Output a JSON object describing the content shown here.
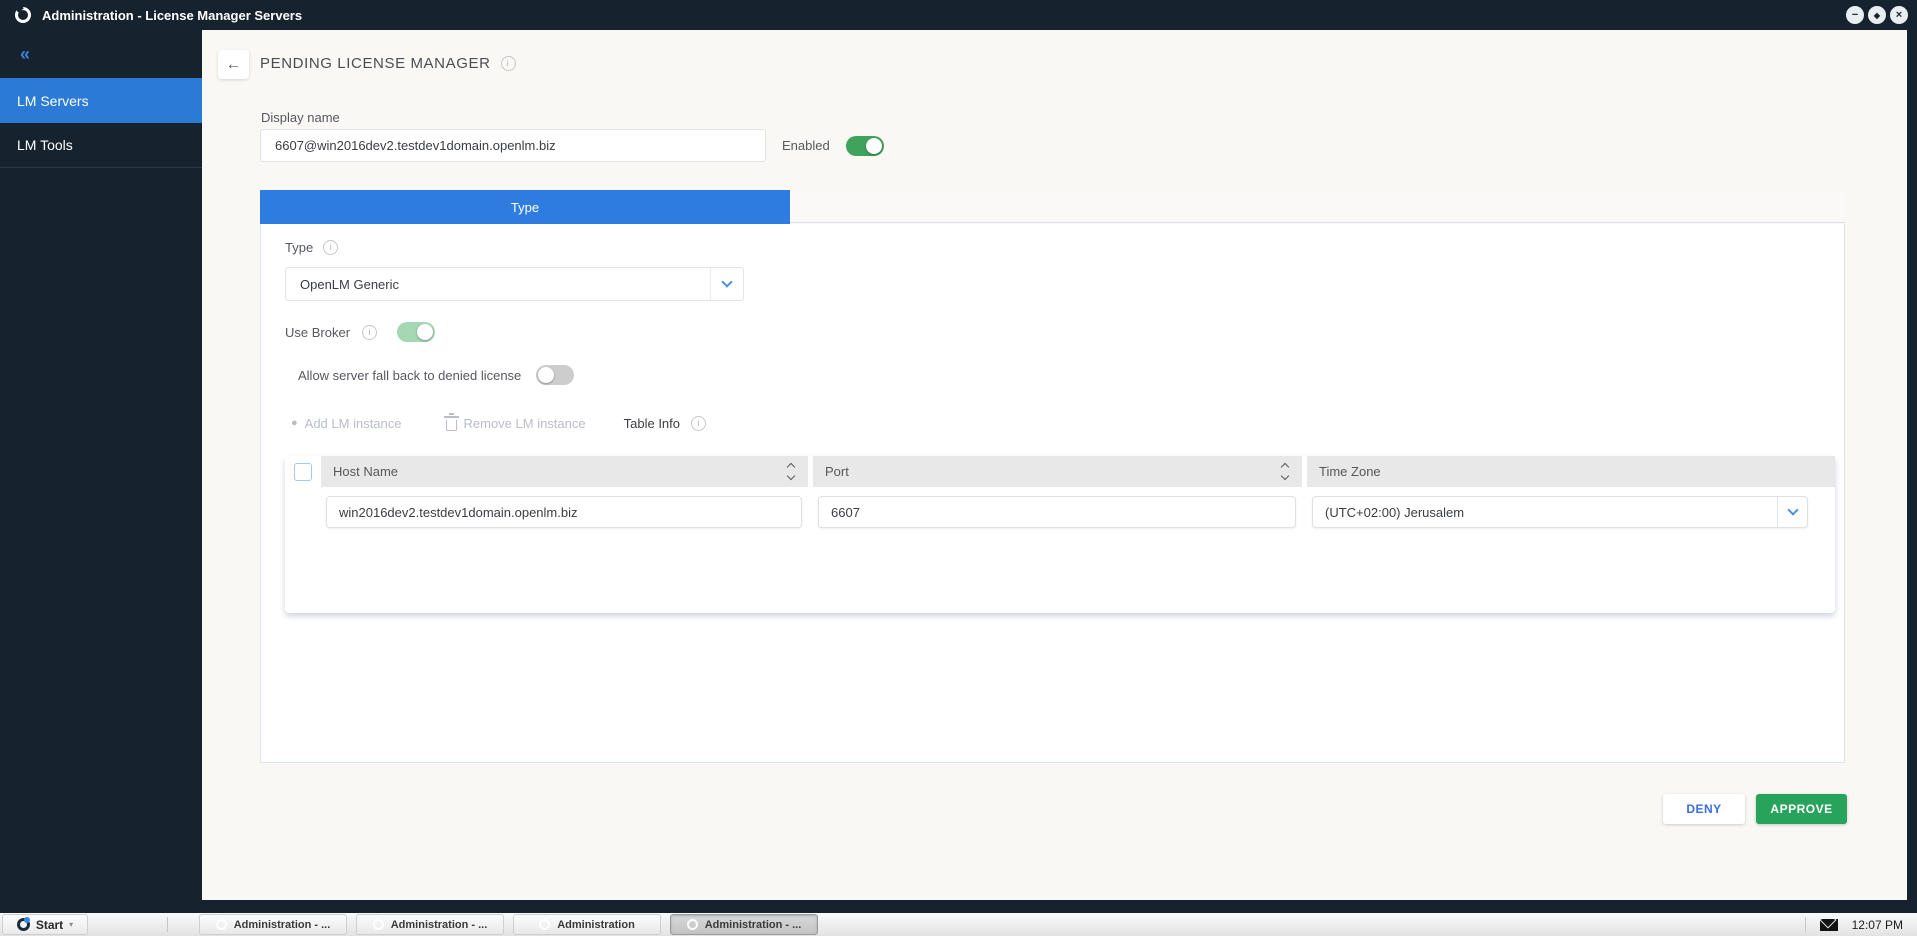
{
  "window": {
    "title": "Administration - License Manager Servers"
  },
  "icons": {
    "back": "←",
    "collapse": "«",
    "info": "i",
    "minimize": "−",
    "restore": "◆",
    "close": "×",
    "add": "●",
    "start_arrow": "▾"
  },
  "sidebar": {
    "items": [
      {
        "label": "LM Servers",
        "active": true
      },
      {
        "label": "LM Tools",
        "active": false
      }
    ]
  },
  "page": {
    "title": "PENDING LICENSE MANAGER"
  },
  "form": {
    "display_name_label": "Display name",
    "display_name_value": "6607@win2016dev2.testdev1domain.openlm.biz",
    "enabled_label": "Enabled",
    "enabled_state": "on",
    "tab_label": "Type",
    "type_label": "Type",
    "type_value": "OpenLM Generic",
    "use_broker_label": "Use Broker",
    "use_broker_state": "on",
    "fallback_label": "Allow server fall back to denied license",
    "fallback_state": "off",
    "add_label": "Add LM instance",
    "remove_label": "Remove LM instance",
    "table_info_label": "Table Info"
  },
  "table": {
    "columns": [
      "Host Name",
      "Port",
      "Time Zone"
    ],
    "rows": [
      {
        "host": "win2016dev2.testdev1domain.openlm.biz",
        "port": "6607",
        "timezone": "(UTC+02:00) Jerusalem"
      }
    ]
  },
  "actions": {
    "deny": "DENY",
    "approve": "APPROVE"
  },
  "taskbar": {
    "start_label": "Start",
    "buttons": [
      {
        "label": "Administration - ...",
        "active": false
      },
      {
        "label": "Administration - ...",
        "active": false
      },
      {
        "label": "Administration",
        "active": false
      },
      {
        "label": "Administration - ...",
        "active": true
      }
    ],
    "clock": "12:07 PM"
  },
  "colors": {
    "titlebar": "#16232f",
    "sidebar_active": "#2b7ad5",
    "tab_blue": "#2e7ce0",
    "toggle_on": "#3ea35c",
    "toggle_on_light": "#a6d7b3",
    "toggle_off": "#cdcdcd",
    "approve_green": "#28a35b",
    "deny_text": "#3b6be4",
    "main_bg": "#faf8f5",
    "table_header_bg": "#e8e8e8"
  }
}
